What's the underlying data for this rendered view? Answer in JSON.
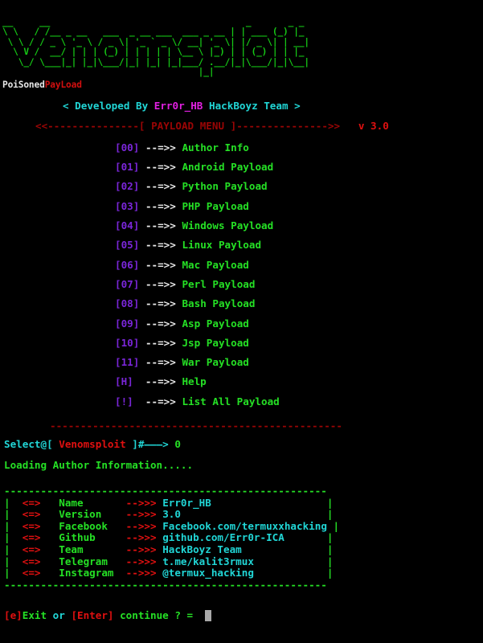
{
  "terminal": {
    "background": "#000000",
    "banner_color": "#16c916",
    "banner_ascii": "__     __                                     _       _ _   \n\\ \\   / /__ _ __   ___  _ __ ___  ___ _ __ | | ___ (_) |_ \n \\ \\ / / _ \\ '_ \\ / _ \\| '_ ` _ \\/ __| '_ \\| |/ _ \\| | __|\n  \\ V /  __/ | | | (_) | | | | | \\__ \\ |_) | | (_) | | |_ \n   \\_/ \\___|_| |_|\\___/|_| |_| |_|___/ .__/|_|\\___/|_|\\__|\n                                     |_|                  ",
    "subtitle_left": " ____       _ ____                   _ ",
    "subtitle_white": "PoiSoned",
    "subtitle_red": "PayLoad",
    "credit": {
      "open": "< Developed By ",
      "author": "Err0r_HB",
      "close": " HackBoyz Team >"
    },
    "menu_header": {
      "left_rule": "<<---------------[ ",
      "title": "PAYLOAD MENU",
      "right_rule": " ]--------------->>",
      "version": "v 3.0"
    },
    "menu_items": [
      {
        "key": "[00]",
        "arrow": "--=>>",
        "label": "Author Info"
      },
      {
        "key": "[01]",
        "arrow": "--=>>",
        "label": "Android Payload"
      },
      {
        "key": "[02]",
        "arrow": "--=>>",
        "label": "Python Payload"
      },
      {
        "key": "[03]",
        "arrow": "--=>>",
        "label": "PHP Payload"
      },
      {
        "key": "[04]",
        "arrow": "--=>>",
        "label": "Windows Payload"
      },
      {
        "key": "[05]",
        "arrow": "--=>>",
        "label": "Linux Payload"
      },
      {
        "key": "[06]",
        "arrow": "--=>>",
        "label": "Mac Payload"
      },
      {
        "key": "[07]",
        "arrow": "--=>>",
        "label": "Perl Payload"
      },
      {
        "key": "[08]",
        "arrow": "--=>>",
        "label": "Bash Payload"
      },
      {
        "key": "[09]",
        "arrow": "--=>>",
        "label": "Asp Payload"
      },
      {
        "key": "[10]",
        "arrow": "--=>>",
        "label": "Jsp Payload"
      },
      {
        "key": "[11]",
        "arrow": "--=>>",
        "label": "War Payload"
      },
      {
        "key": "[H]",
        "arrow": "--=>>",
        "label": "Help"
      },
      {
        "key": "[!]",
        "arrow": "--=>>",
        "label": "List All Payload"
      }
    ],
    "separator": "------------------------------------------------",
    "prompt": {
      "label": "Select@[",
      "host": " Venomsploit ",
      "tail": "]#———>",
      "value": "0"
    },
    "loading_text": "Loading Author Information.....",
    "info_box": {
      "top_border": "-----------------------------------------------------",
      "bottom_border": "-----------------------------------------------------",
      "side": "|",
      "bullet": "<=>",
      "connector": "-->>>",
      "rows": [
        {
          "label": "Name",
          "value": "Err0r_HB"
        },
        {
          "label": "Version",
          "value": "3.0"
        },
        {
          "label": "Facebook",
          "value": "Facebook.com/termuxxhacking"
        },
        {
          "label": "Github",
          "value": "github.com/Err0r-ICA"
        },
        {
          "label": "Team",
          "value": "HackBoyz Team"
        },
        {
          "label": "Telegram",
          "value": "t.me/kalit3rmux"
        },
        {
          "label": "Instagram",
          "value": "@termux_hacking"
        }
      ]
    },
    "footer": {
      "exit_key": "[e]",
      "exit_word": "Exit",
      "or_word": " or ",
      "enter_key": "[Enter]",
      "continue_text": " continue ? ="
    },
    "colors": {
      "green": "#25e025",
      "cyan": "#21d6d6",
      "magenta": "#e020e0",
      "red": "#e01010",
      "dark_red": "#9b0505",
      "violet": "#7a26d9",
      "white": "#e8e8e8",
      "cursor": "#a8a8a8"
    }
  }
}
